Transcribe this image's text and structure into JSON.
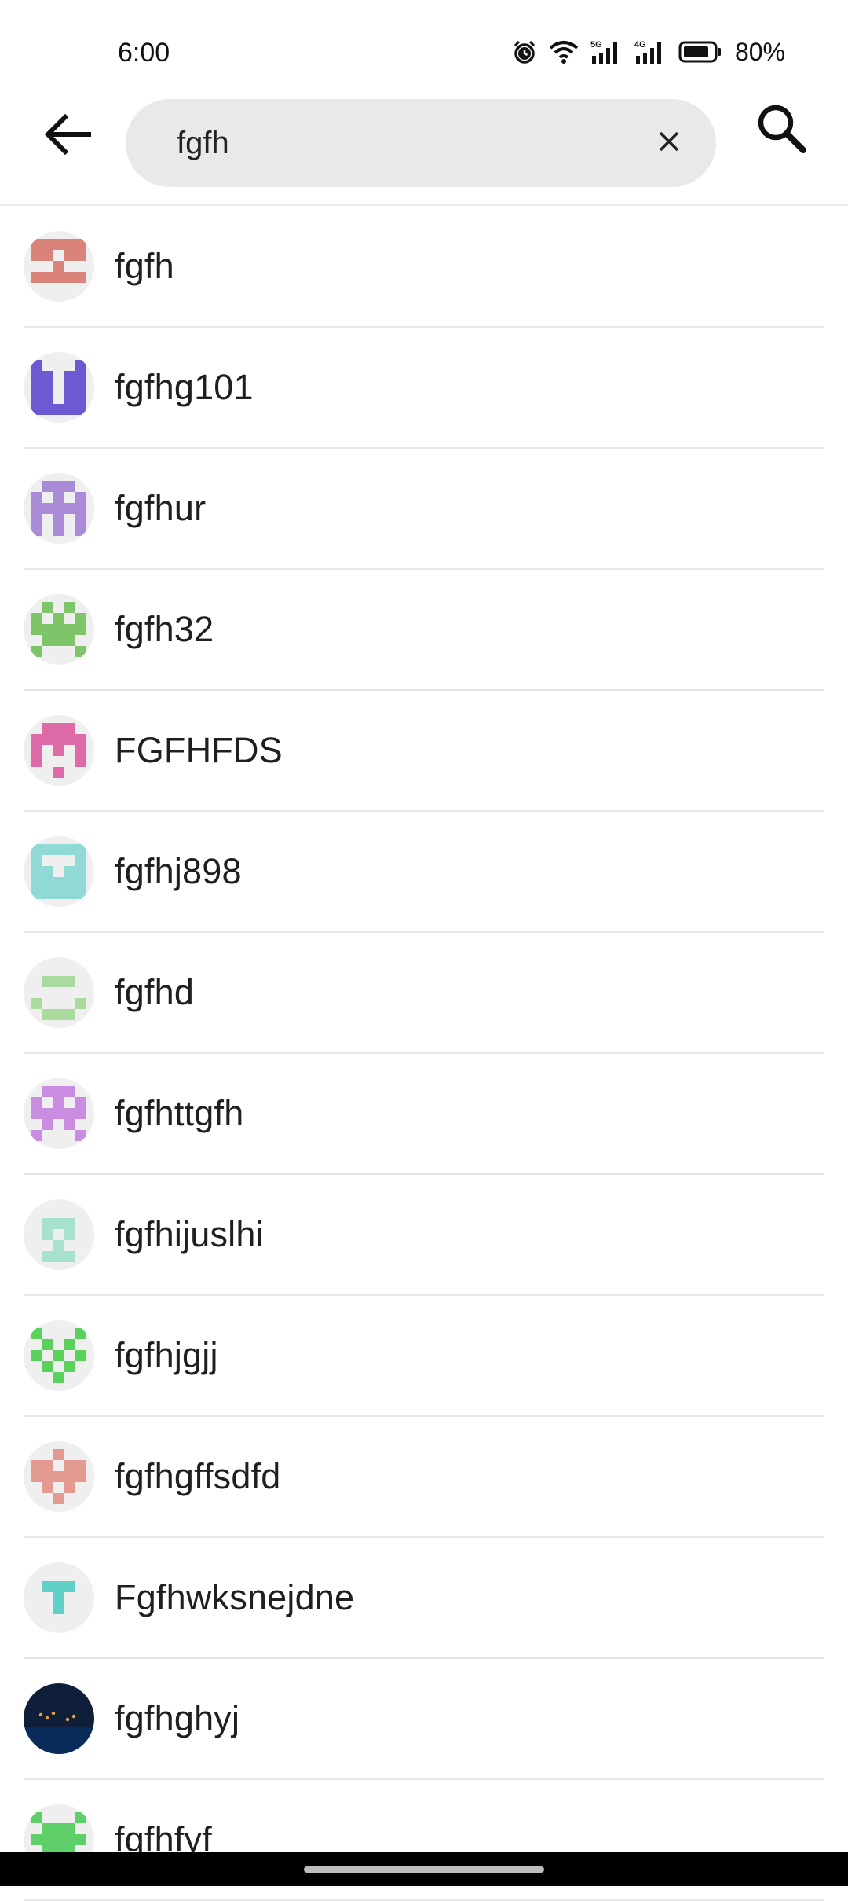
{
  "status": {
    "time": "6:00",
    "battery": "80%",
    "network": [
      "5G",
      "4G"
    ]
  },
  "search": {
    "query": "fgfh",
    "placeholder": ""
  },
  "icons": {
    "back": "arrow-back-icon",
    "clear": "close-icon",
    "search": "search-icon"
  },
  "results": [
    {
      "name": "fgfh",
      "color": "#d9837a"
    },
    {
      "name": "fgfhg101",
      "color": "#6b5ad1"
    },
    {
      "name": "fgfhur",
      "color": "#a98bd8"
    },
    {
      "name": "fgfh32",
      "color": "#7ec56a"
    },
    {
      "name": "FGFHFDS",
      "color": "#de6aa8"
    },
    {
      "name": "fgfhj898",
      "color": "#91d9d4"
    },
    {
      "name": "fgfhd",
      "color": "#a9dba0"
    },
    {
      "name": "fgfhttgfh",
      "color": "#c88de0"
    },
    {
      "name": "fgfhijuslhi",
      "color": "#a7e1cf"
    },
    {
      "name": "fgfhjgjj",
      "color": "#5ad15a"
    },
    {
      "name": "fgfhgffsdfd",
      "color": "#e39a90"
    },
    {
      "name": "Fgfhwksnejdne",
      "color": "#5fd1c7"
    },
    {
      "name": "fgfhghyj",
      "color": "#0f1f3a"
    },
    {
      "name": "fgfhfyf",
      "color": "#5fcf6a"
    }
  ]
}
